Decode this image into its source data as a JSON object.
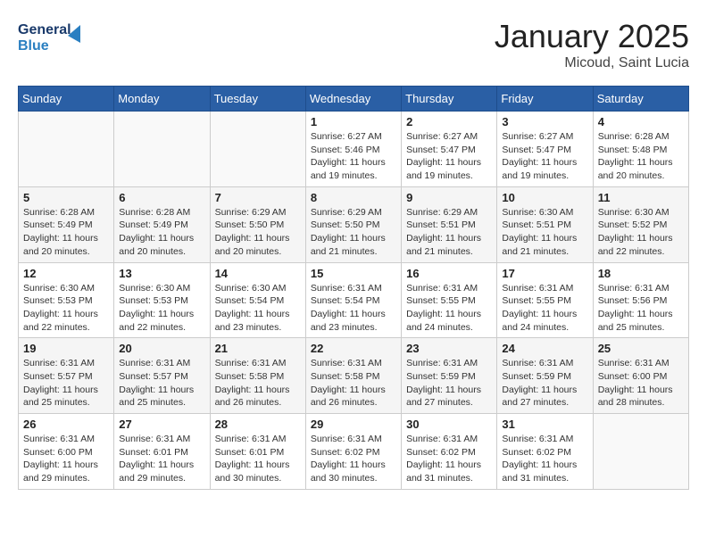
{
  "header": {
    "logo_line1": "General",
    "logo_line2": "Blue",
    "month": "January 2025",
    "location": "Micoud, Saint Lucia"
  },
  "weekdays": [
    "Sunday",
    "Monday",
    "Tuesday",
    "Wednesday",
    "Thursday",
    "Friday",
    "Saturday"
  ],
  "weeks": [
    [
      {
        "day": "",
        "info": ""
      },
      {
        "day": "",
        "info": ""
      },
      {
        "day": "",
        "info": ""
      },
      {
        "day": "1",
        "info": "Sunrise: 6:27 AM\nSunset: 5:46 PM\nDaylight: 11 hours\nand 19 minutes."
      },
      {
        "day": "2",
        "info": "Sunrise: 6:27 AM\nSunset: 5:47 PM\nDaylight: 11 hours\nand 19 minutes."
      },
      {
        "day": "3",
        "info": "Sunrise: 6:27 AM\nSunset: 5:47 PM\nDaylight: 11 hours\nand 19 minutes."
      },
      {
        "day": "4",
        "info": "Sunrise: 6:28 AM\nSunset: 5:48 PM\nDaylight: 11 hours\nand 20 minutes."
      }
    ],
    [
      {
        "day": "5",
        "info": "Sunrise: 6:28 AM\nSunset: 5:49 PM\nDaylight: 11 hours\nand 20 minutes."
      },
      {
        "day": "6",
        "info": "Sunrise: 6:28 AM\nSunset: 5:49 PM\nDaylight: 11 hours\nand 20 minutes."
      },
      {
        "day": "7",
        "info": "Sunrise: 6:29 AM\nSunset: 5:50 PM\nDaylight: 11 hours\nand 20 minutes."
      },
      {
        "day": "8",
        "info": "Sunrise: 6:29 AM\nSunset: 5:50 PM\nDaylight: 11 hours\nand 21 minutes."
      },
      {
        "day": "9",
        "info": "Sunrise: 6:29 AM\nSunset: 5:51 PM\nDaylight: 11 hours\nand 21 minutes."
      },
      {
        "day": "10",
        "info": "Sunrise: 6:30 AM\nSunset: 5:51 PM\nDaylight: 11 hours\nand 21 minutes."
      },
      {
        "day": "11",
        "info": "Sunrise: 6:30 AM\nSunset: 5:52 PM\nDaylight: 11 hours\nand 22 minutes."
      }
    ],
    [
      {
        "day": "12",
        "info": "Sunrise: 6:30 AM\nSunset: 5:53 PM\nDaylight: 11 hours\nand 22 minutes."
      },
      {
        "day": "13",
        "info": "Sunrise: 6:30 AM\nSunset: 5:53 PM\nDaylight: 11 hours\nand 22 minutes."
      },
      {
        "day": "14",
        "info": "Sunrise: 6:30 AM\nSunset: 5:54 PM\nDaylight: 11 hours\nand 23 minutes."
      },
      {
        "day": "15",
        "info": "Sunrise: 6:31 AM\nSunset: 5:54 PM\nDaylight: 11 hours\nand 23 minutes."
      },
      {
        "day": "16",
        "info": "Sunrise: 6:31 AM\nSunset: 5:55 PM\nDaylight: 11 hours\nand 24 minutes."
      },
      {
        "day": "17",
        "info": "Sunrise: 6:31 AM\nSunset: 5:55 PM\nDaylight: 11 hours\nand 24 minutes."
      },
      {
        "day": "18",
        "info": "Sunrise: 6:31 AM\nSunset: 5:56 PM\nDaylight: 11 hours\nand 25 minutes."
      }
    ],
    [
      {
        "day": "19",
        "info": "Sunrise: 6:31 AM\nSunset: 5:57 PM\nDaylight: 11 hours\nand 25 minutes."
      },
      {
        "day": "20",
        "info": "Sunrise: 6:31 AM\nSunset: 5:57 PM\nDaylight: 11 hours\nand 25 minutes."
      },
      {
        "day": "21",
        "info": "Sunrise: 6:31 AM\nSunset: 5:58 PM\nDaylight: 11 hours\nand 26 minutes."
      },
      {
        "day": "22",
        "info": "Sunrise: 6:31 AM\nSunset: 5:58 PM\nDaylight: 11 hours\nand 26 minutes."
      },
      {
        "day": "23",
        "info": "Sunrise: 6:31 AM\nSunset: 5:59 PM\nDaylight: 11 hours\nand 27 minutes."
      },
      {
        "day": "24",
        "info": "Sunrise: 6:31 AM\nSunset: 5:59 PM\nDaylight: 11 hours\nand 27 minutes."
      },
      {
        "day": "25",
        "info": "Sunrise: 6:31 AM\nSunset: 6:00 PM\nDaylight: 11 hours\nand 28 minutes."
      }
    ],
    [
      {
        "day": "26",
        "info": "Sunrise: 6:31 AM\nSunset: 6:00 PM\nDaylight: 11 hours\nand 29 minutes."
      },
      {
        "day": "27",
        "info": "Sunrise: 6:31 AM\nSunset: 6:01 PM\nDaylight: 11 hours\nand 29 minutes."
      },
      {
        "day": "28",
        "info": "Sunrise: 6:31 AM\nSunset: 6:01 PM\nDaylight: 11 hours\nand 30 minutes."
      },
      {
        "day": "29",
        "info": "Sunrise: 6:31 AM\nSunset: 6:02 PM\nDaylight: 11 hours\nand 30 minutes."
      },
      {
        "day": "30",
        "info": "Sunrise: 6:31 AM\nSunset: 6:02 PM\nDaylight: 11 hours\nand 31 minutes."
      },
      {
        "day": "31",
        "info": "Sunrise: 6:31 AM\nSunset: 6:02 PM\nDaylight: 11 hours\nand 31 minutes."
      },
      {
        "day": "",
        "info": ""
      }
    ]
  ]
}
